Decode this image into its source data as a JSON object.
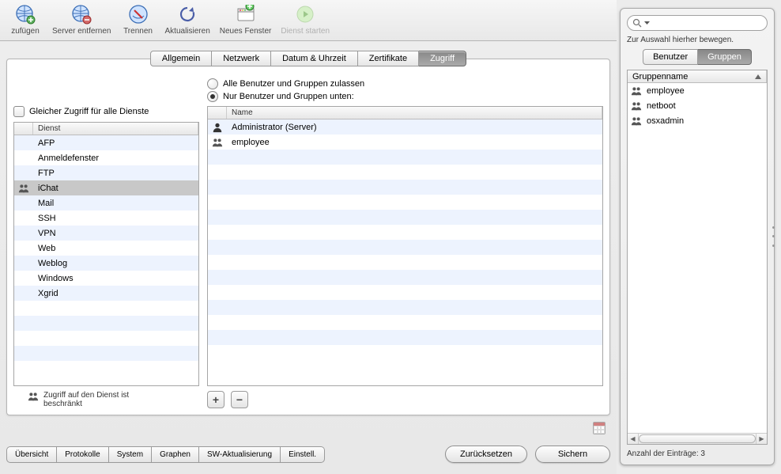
{
  "toolbar": {
    "items": [
      {
        "id": "add",
        "label": "zufügen"
      },
      {
        "id": "remove",
        "label": "Server entfernen"
      },
      {
        "id": "disconnect",
        "label": "Trennen"
      },
      {
        "id": "refresh",
        "label": "Aktualisieren"
      },
      {
        "id": "newwin",
        "label": "Neues Fenster"
      },
      {
        "id": "start",
        "label": "Dienst starten",
        "disabled": true
      }
    ]
  },
  "tabs": [
    "Allgemein",
    "Netzwerk",
    "Datum & Uhrzeit",
    "Zertifikate",
    "Zugriff"
  ],
  "tabs_selected": 4,
  "zugriff": {
    "same_access_label": "Gleicher Zugriff für alle Dienste",
    "radio_all": "Alle Benutzer und Gruppen zulassen",
    "radio_only": "Nur Benutzer und Gruppen unten:",
    "radio_selected": "only",
    "services_header": "Dienst",
    "services": [
      {
        "name": "AFP"
      },
      {
        "name": "Anmeldefenster"
      },
      {
        "name": "FTP"
      },
      {
        "name": "iChat",
        "selected": true,
        "icon": "group"
      },
      {
        "name": "Mail"
      },
      {
        "name": "SSH"
      },
      {
        "name": "VPN"
      },
      {
        "name": "Web"
      },
      {
        "name": "Weblog"
      },
      {
        "name": "Windows"
      },
      {
        "name": "Xgrid"
      }
    ],
    "restricted_note": "Zugriff auf den Dienst ist beschränkt",
    "name_header": "Name",
    "allowed": [
      {
        "name": "Administrator (Server)",
        "icon": "user"
      },
      {
        "name": "employee",
        "icon": "group"
      }
    ],
    "add_btn": "+",
    "remove_btn": "−"
  },
  "bottom_tabs": [
    "Übersicht",
    "Protokolle",
    "System",
    "Graphen",
    "SW-Aktualisierung",
    "Einstell."
  ],
  "buttons": {
    "reset": "Zurücksetzen",
    "save": "Sichern"
  },
  "drawer": {
    "search_placeholder": "",
    "hint": "Zur Auswahl hierher bewegen.",
    "tabs": [
      "Benutzer",
      "Gruppen"
    ],
    "tabs_selected": 1,
    "column": "Gruppenname",
    "groups": [
      {
        "name": "employee"
      },
      {
        "name": "netboot"
      },
      {
        "name": "osxadmin"
      }
    ],
    "count_label": "Anzahl der Einträge: 3"
  }
}
